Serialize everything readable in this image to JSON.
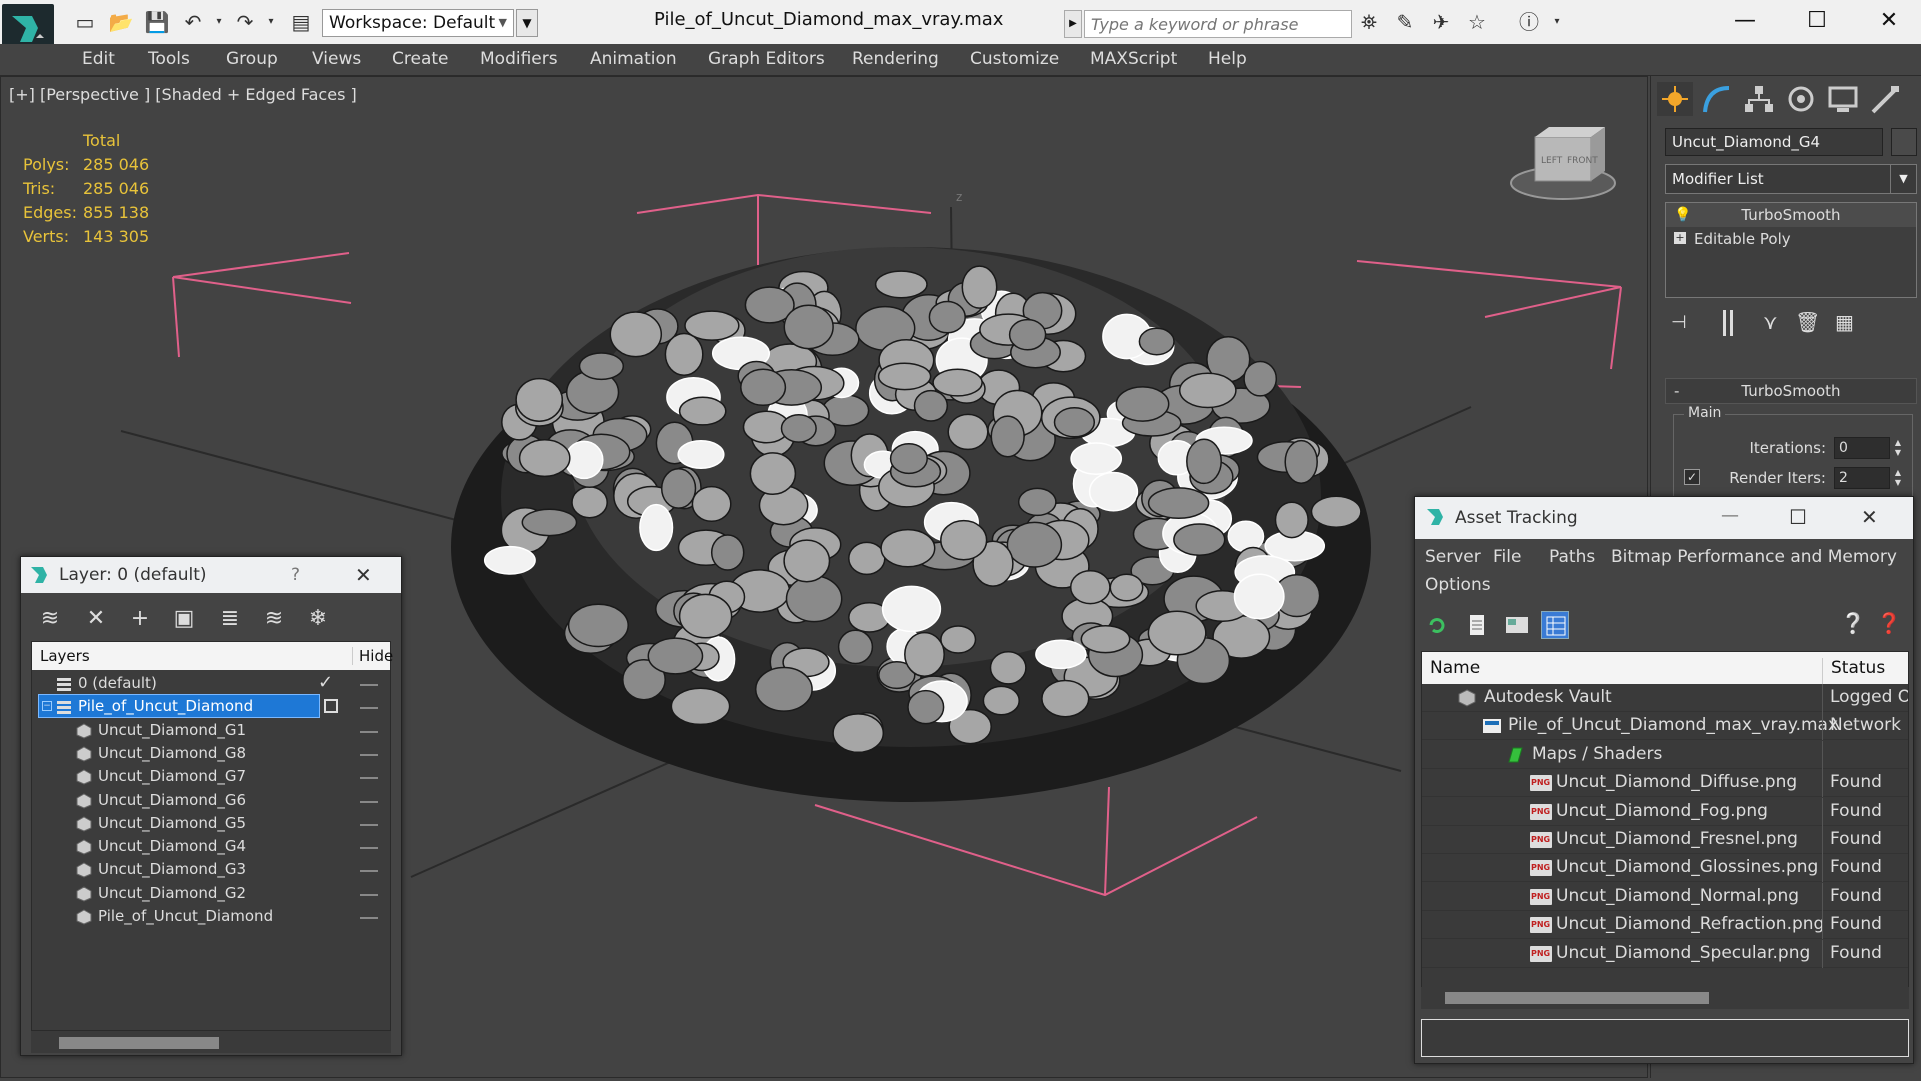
{
  "app": {
    "document_title": "Pile_of_Uncut_Diamond_max_vray.max",
    "workspace": "Workspace: Default",
    "search_placeholder": "Type a keyword or phrase",
    "minimize": "—",
    "maximize": "☐",
    "close": "✕"
  },
  "menu": [
    "Edit",
    "Tools",
    "Group",
    "Views",
    "Create",
    "Modifiers",
    "Animation",
    "Graph Editors",
    "Rendering",
    "Customize",
    "MAXScript",
    "Help"
  ],
  "viewport": {
    "label": "[+] [Perspective ] [Shaded + Edged Faces ]",
    "stats_header": "Total",
    "stats": [
      {
        "key": "Polys:",
        "value": "285 046"
      },
      {
        "key": "Tris:",
        "value": "285 046"
      },
      {
        "key": "Edges:",
        "value": "855 138"
      },
      {
        "key": "Verts:",
        "value": "143 305"
      }
    ],
    "axis_label": "z",
    "viewcube_left": "LEFT",
    "viewcube_front": "FRONT"
  },
  "command_panel": {
    "object_name": "Uncut_Diamond_G4",
    "modifier_list": "Modifier List",
    "stack": [
      "TurboSmooth",
      "Editable Poly"
    ],
    "rollout_title": "TurboSmooth",
    "rollout_toggle": "-",
    "group_main": "Main",
    "iterations_label": "Iterations:",
    "iterations_value": "0",
    "render_iters_label": "Render Iters:",
    "render_iters_value": "2",
    "render_iters_checked": "✓"
  },
  "layer_dialog": {
    "title": "Layer: 0 (default)",
    "help": "?",
    "close": "✕",
    "col_layers": "Layers",
    "col_hide": "Hide",
    "rows": [
      {
        "name": "0 (default)",
        "type": "layer",
        "indent": 0
      },
      {
        "name": "Pile_of_Uncut_Diamond",
        "type": "layer",
        "indent": 0,
        "selected": true
      },
      {
        "name": "Uncut_Diamond_G1",
        "type": "object",
        "indent": 1
      },
      {
        "name": "Uncut_Diamond_G8",
        "type": "object",
        "indent": 1
      },
      {
        "name": "Uncut_Diamond_G7",
        "type": "object",
        "indent": 1
      },
      {
        "name": "Uncut_Diamond_G6",
        "type": "object",
        "indent": 1
      },
      {
        "name": "Uncut_Diamond_G5",
        "type": "object",
        "indent": 1
      },
      {
        "name": "Uncut_Diamond_G4",
        "type": "object",
        "indent": 1
      },
      {
        "name": "Uncut_Diamond_G3",
        "type": "object",
        "indent": 1
      },
      {
        "name": "Uncut_Diamond_G2",
        "type": "object",
        "indent": 1
      },
      {
        "name": "Pile_of_Uncut_Diamond",
        "type": "object",
        "indent": 1
      }
    ]
  },
  "asset_dialog": {
    "title": "Asset Tracking",
    "min": "—",
    "max": "☐",
    "close": "✕",
    "menu": [
      "Server",
      "File",
      "Paths",
      "Bitmap Performance and Memory",
      "Options"
    ],
    "col_name": "Name",
    "col_status": "Status",
    "rows": [
      {
        "name": "Autodesk Vault",
        "status": "Logged O",
        "indent": 0,
        "icon": "vault"
      },
      {
        "name": "Pile_of_Uncut_Diamond_max_vray.max",
        "status": "Network P",
        "indent": 1,
        "icon": "max"
      },
      {
        "name": "Maps / Shaders",
        "status": "",
        "indent": 2,
        "icon": "maps"
      },
      {
        "name": "Uncut_Diamond_Diffuse.png",
        "status": "Found",
        "indent": 3,
        "icon": "png"
      },
      {
        "name": "Uncut_Diamond_Fog.png",
        "status": "Found",
        "indent": 3,
        "icon": "png"
      },
      {
        "name": "Uncut_Diamond_Fresnel.png",
        "status": "Found",
        "indent": 3,
        "icon": "png"
      },
      {
        "name": "Uncut_Diamond_Glossines.png",
        "status": "Found",
        "indent": 3,
        "icon": "png"
      },
      {
        "name": "Uncut_Diamond_Normal.png",
        "status": "Found",
        "indent": 3,
        "icon": "png"
      },
      {
        "name": "Uncut_Diamond_Refraction.png",
        "status": "Found",
        "indent": 3,
        "icon": "png"
      },
      {
        "name": "Uncut_Diamond_Specular.png",
        "status": "Found",
        "indent": 3,
        "icon": "png"
      }
    ]
  }
}
